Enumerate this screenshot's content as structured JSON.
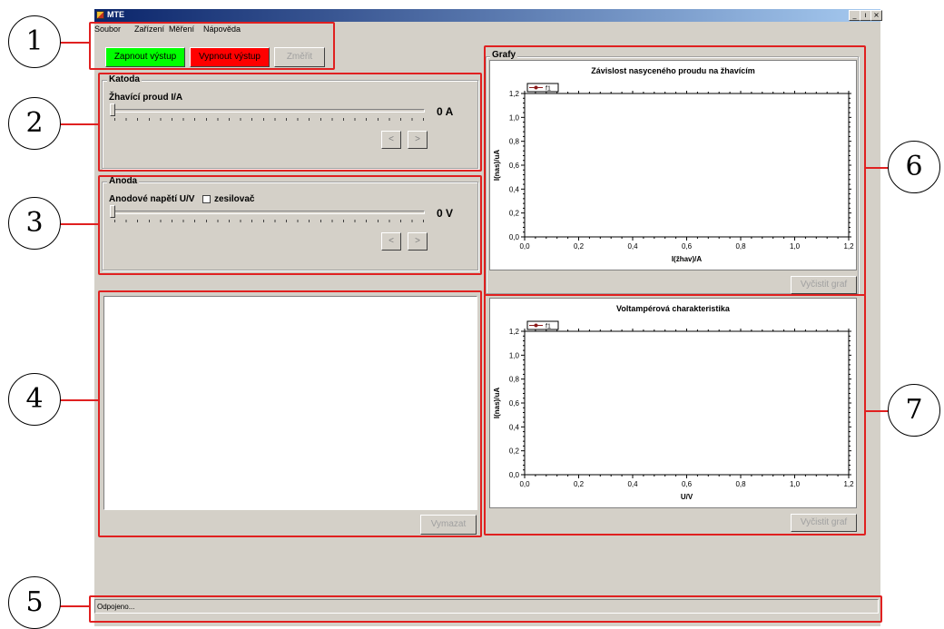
{
  "window": {
    "title": "MTE",
    "controls": [
      "_",
      "ı",
      "×"
    ]
  },
  "menu": [
    "Soubor",
    "Zařízení",
    "Měření",
    "Nápověda"
  ],
  "toolbar": {
    "on_label": "Zapnout výstup",
    "off_label": "Vypnout výstup",
    "measure_label": "Změřit"
  },
  "katoda": {
    "title": "Katoda",
    "label": "Žhavící proud I/A",
    "value": "0 A",
    "slider_level": 0,
    "prev": "<",
    "next": ">"
  },
  "anoda": {
    "title": "Anoda",
    "label": "Anodové napětí U/V",
    "checkbox_label": "zesilovač",
    "checkbox_checked": false,
    "value": "0 V",
    "slider_level": 0,
    "prev": "<",
    "next": ">"
  },
  "log": {
    "clear_label": "Vymazat"
  },
  "status": {
    "text": "Odpojeno..."
  },
  "grafy": {
    "title": "Grafy",
    "clear_label": "Vyčistit graf"
  },
  "callouts": [
    "1",
    "2",
    "3",
    "4",
    "5",
    "6",
    "7"
  ],
  "chart_data": [
    {
      "type": "line",
      "title": "Závislost nasyceného proudu na žhavícím",
      "xlabel": "I(žhav)/A",
      "ylabel": "I(nas)/uA",
      "xlim": [
        0,
        1.2
      ],
      "ylim": [
        0,
        1.2
      ],
      "xticks": [
        "0,0",
        "0,2",
        "0,4",
        "0,6",
        "0,8",
        "1,0",
        "1,2"
      ],
      "yticks": [
        "0,0",
        "0,2",
        "0,4",
        "0,6",
        "0,8",
        "1,0",
        "1,2"
      ],
      "legend": "top-left",
      "series": [
        {
          "name": "f1",
          "color": "#8b1a1a",
          "x": [],
          "y": []
        }
      ]
    },
    {
      "type": "line",
      "title": "Voltampérová charakteristika",
      "xlabel": "U/V",
      "ylabel": "I(nas)/uA",
      "xlim": [
        0,
        1.2
      ],
      "ylim": [
        0,
        1.2
      ],
      "xticks": [
        "0,0",
        "0,2",
        "0,4",
        "0,6",
        "0,8",
        "1,0",
        "1,2"
      ],
      "yticks": [
        "0,0",
        "0,2",
        "0,4",
        "0,6",
        "0,8",
        "1,0",
        "1,2"
      ],
      "legend": "top-left",
      "series": [
        {
          "name": "f1",
          "color": "#8b1a1a",
          "x": [],
          "y": []
        }
      ]
    }
  ],
  "colors": {
    "on_button": "#00ff00",
    "off_button": "#ff0000",
    "callout_box": "#e02020",
    "window_bg": "#d4d0c8"
  }
}
